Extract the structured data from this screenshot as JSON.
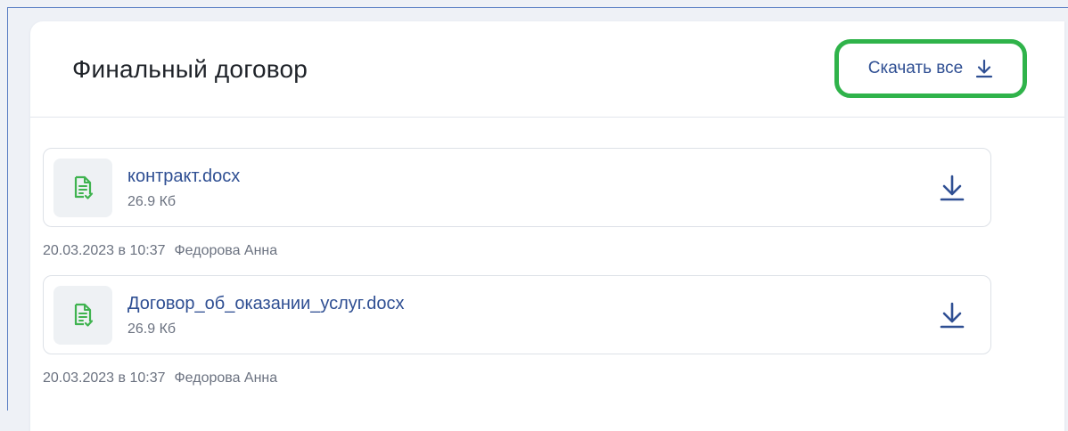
{
  "card": {
    "title": "Финальный договор",
    "download_all_label": "Скачать все"
  },
  "colors": {
    "link": "#2f4f93",
    "highlight": "#2fb34a",
    "file_icon": "#3fb34f"
  },
  "files": [
    {
      "name": "контракт.docx",
      "size": "26.9 Кб",
      "date": "20.03.2023 в 10:37",
      "author": "Федорова Анна",
      "icon": "document-check-icon"
    },
    {
      "name": "Договор_об_оказании_услуг.docx",
      "size": "26.9 Кб",
      "date": "20.03.2023 в 10:37",
      "author": "Федорова Анна",
      "icon": "document-check-icon"
    }
  ]
}
